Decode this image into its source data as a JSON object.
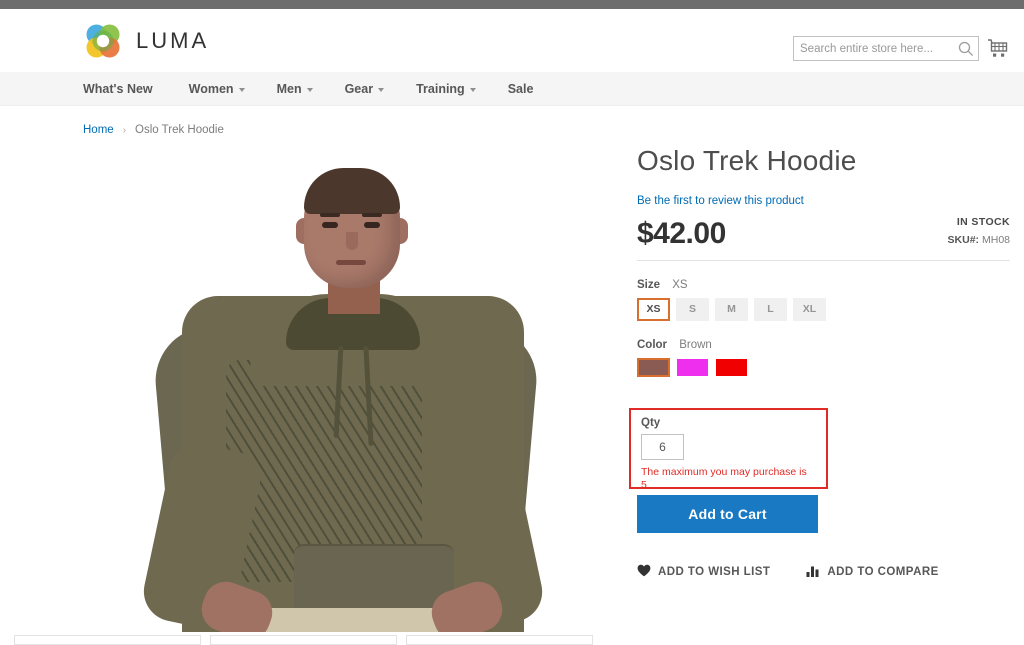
{
  "header": {
    "logo_text": "LUMA",
    "logo_icon": "luma-flower-logo",
    "search": {
      "placeholder": "Search entire store here...",
      "value": "",
      "icon": "search-icon"
    },
    "cart_icon": "shopping-cart-icon"
  },
  "nav": {
    "items": [
      {
        "label": "What's New",
        "has_caret": false
      },
      {
        "label": "Women",
        "has_caret": true
      },
      {
        "label": "Men",
        "has_caret": true
      },
      {
        "label": "Gear",
        "has_caret": true
      },
      {
        "label": "Training",
        "has_caret": true
      },
      {
        "label": "Sale",
        "has_caret": false
      }
    ]
  },
  "breadcrumb": {
    "home": "Home",
    "separator": "›",
    "current": "Oslo Trek Hoodie"
  },
  "product": {
    "title": "Oslo Trek Hoodie",
    "review_link": "Be the first to review this product",
    "price": "$42.00",
    "stock_status": "IN STOCK",
    "sku_label": "SKU#:",
    "sku_value": "MH08",
    "size": {
      "label": "Size",
      "selected": "XS",
      "options": [
        {
          "label": "XS",
          "selected": true
        },
        {
          "label": "S",
          "selected": false
        },
        {
          "label": "M",
          "selected": false
        },
        {
          "label": "L",
          "selected": false
        },
        {
          "label": "XL",
          "selected": false
        }
      ]
    },
    "color": {
      "label": "Color",
      "selected": "Brown",
      "options": [
        {
          "name": "Brown",
          "hex": "#8a5b52",
          "selected": true
        },
        {
          "name": "Purple",
          "hex": "#ee30ee",
          "selected": false
        },
        {
          "name": "Red",
          "hex": "#f00000",
          "selected": false
        }
      ]
    },
    "qty": {
      "label": "Qty",
      "value": "6",
      "error": "The maximum you may purchase is 5.",
      "error_color": "#e02b27"
    },
    "add_to_cart": "Add to Cart",
    "wish_list": "ADD TO WISH LIST",
    "compare": "ADD TO COMPARE",
    "wish_icon": "heart-icon",
    "compare_icon": "bar-chart-icon",
    "image_alt": "Oslo Trek Hoodie worn by model"
  },
  "colors": {
    "accent_blue": "#1979c3",
    "link_blue": "#006bb4",
    "selected_border": "#d96f2f",
    "error_red": "#e02b27",
    "topbar_gray": "#6d6d6d",
    "nav_band": "#f5f5f5"
  }
}
